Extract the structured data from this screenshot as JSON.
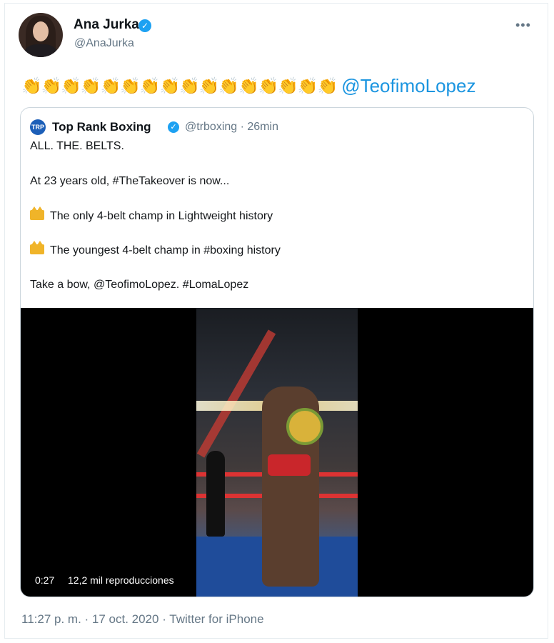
{
  "tweet": {
    "author_name": "Ana Jurka",
    "author_handle": "@AnaJurka",
    "claps": "👏👏👏👏👏👏👏👏👏👏👏👏👏👏👏👏",
    "mention": "@TeofimoLopez",
    "meta": "11:27 p. m. · 17 oct. 2020 · Twitter for iPhone"
  },
  "quote": {
    "avatar_text": "TRP",
    "name": "Top Rank Boxing",
    "handle_time": "@trboxing · 26min",
    "line1": "ALL. THE. BELTS.",
    "line2": "At 23 years old, #TheTakeover is now...",
    "line3": "The only 4-belt champ in Lightweight history",
    "line4": "The youngest 4-belt champ in #boxing history",
    "line5": "Take a bow, @TeofimoLopez. #LomaLopez"
  },
  "video": {
    "time": "0:27",
    "views": "12,2 mil reproducciones"
  },
  "icons": {
    "verified": "verified-check-icon",
    "more": "more-options-icon",
    "crown": "crown-icon"
  },
  "colors": {
    "link": "#1b95e0",
    "verified": "#1da1f2",
    "muted": "#657786"
  }
}
